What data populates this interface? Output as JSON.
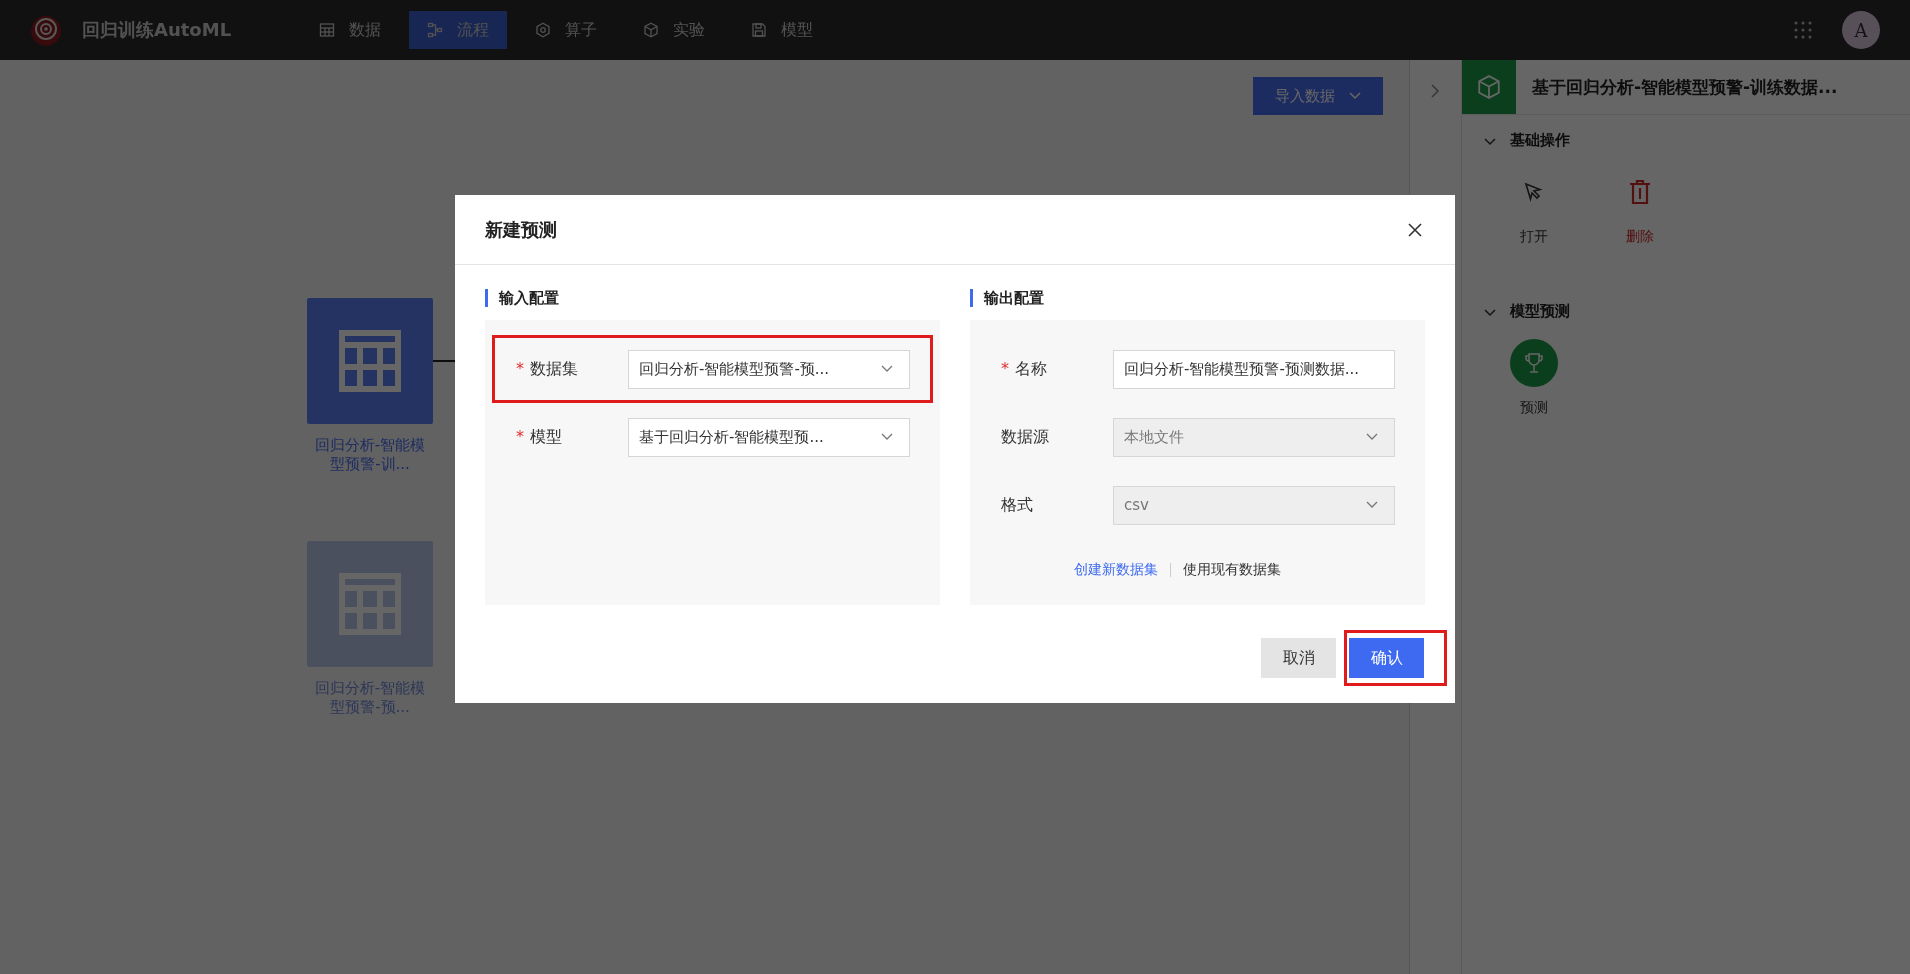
{
  "app": {
    "title": "回归训练AutoML",
    "avatar": "A"
  },
  "nav": [
    {
      "label": "数据",
      "selected": false
    },
    {
      "label": "流程",
      "selected": true
    },
    {
      "label": "算子",
      "selected": false
    },
    {
      "label": "实验",
      "selected": false
    },
    {
      "label": "模型",
      "selected": false
    }
  ],
  "canvas": {
    "import_button": "导入数据",
    "nodes": [
      {
        "label": "回归分析-智能模型预警-训...",
        "disabled": false,
        "connected": true
      },
      {
        "label": "回归分析-智能模型预警-预...",
        "disabled": true,
        "connected": false
      }
    ]
  },
  "side_panel": {
    "title": "基于回归分析-智能模型预警-训练数据...",
    "sections": [
      {
        "title": "基础操作",
        "expanded": true,
        "items": [
          {
            "label": "打开",
            "kind": "open",
            "danger": false
          },
          {
            "label": "删除",
            "kind": "delete",
            "danger": true
          }
        ]
      },
      {
        "title": "模型预测",
        "expanded": true,
        "items": [
          {
            "label": "预测",
            "kind": "predict",
            "danger": false
          }
        ]
      }
    ]
  },
  "dialog": {
    "title": "新建预测",
    "sections": [
      {
        "title": "输入配置",
        "fields": [
          {
            "kind": "select",
            "required_mark": "*",
            "label": "数据集",
            "value": "回归分析-智能模型预警-预...",
            "disabled": false,
            "highlighted": true
          },
          {
            "kind": "select",
            "required_mark": "*",
            "label": "模型",
            "value": "基于回归分析-智能模型预...",
            "disabled": false,
            "highlighted": false
          }
        ]
      },
      {
        "title": "输出配置",
        "fields": [
          {
            "kind": "input",
            "required_mark": "*",
            "label": "名称",
            "value": "回归分析-智能模型预警-预测数据...",
            "disabled": false,
            "highlighted": false
          },
          {
            "kind": "select",
            "label": "数据源",
            "value": "本地文件",
            "disabled": true,
            "highlighted": false
          },
          {
            "kind": "select",
            "label": "格式",
            "value": "csv",
            "disabled": true,
            "highlighted": false
          }
        ],
        "links": [
          {
            "label": "创建新数据集",
            "selected": true
          },
          {
            "label": "使用现有数据集",
            "selected": false
          }
        ]
      }
    ],
    "buttons": [
      {
        "label": "取消",
        "kind": "secondary",
        "highlighted": false
      },
      {
        "label": "确认",
        "kind": "primary",
        "highlighted": true
      }
    ]
  }
}
